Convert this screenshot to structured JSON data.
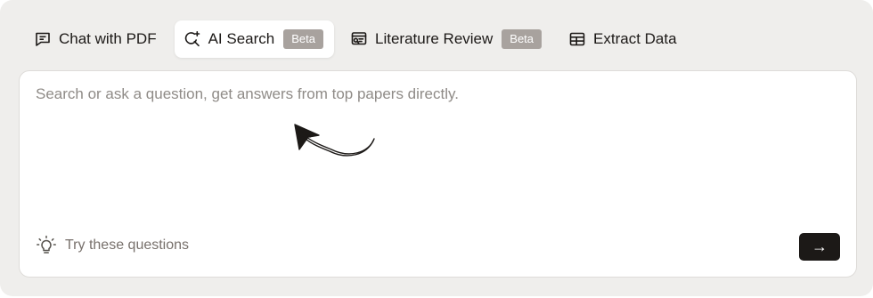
{
  "tabs": [
    {
      "label": "Chat with PDF",
      "icon": "chat-icon",
      "active": false,
      "badge": ""
    },
    {
      "label": "AI Search",
      "icon": "ai-search-icon",
      "active": true,
      "badge": "Beta"
    },
    {
      "label": "Literature Review",
      "icon": "literature-review-icon",
      "active": false,
      "badge": "Beta"
    },
    {
      "label": "Extract Data",
      "icon": "table-icon",
      "active": false,
      "badge": ""
    }
  ],
  "search": {
    "placeholder": "Search or ask a question, get answers from top papers directly.",
    "value": ""
  },
  "suggestions": {
    "label": "Try these questions",
    "icon": "lightbulb-icon"
  },
  "submit": {
    "label": "→",
    "icon": "arrow-right-icon"
  },
  "colors": {
    "panel_bg": "#efeeec",
    "badge_bg": "#a8a29e",
    "submit_bg": "#1c1917",
    "placeholder": "#8f8b87"
  }
}
